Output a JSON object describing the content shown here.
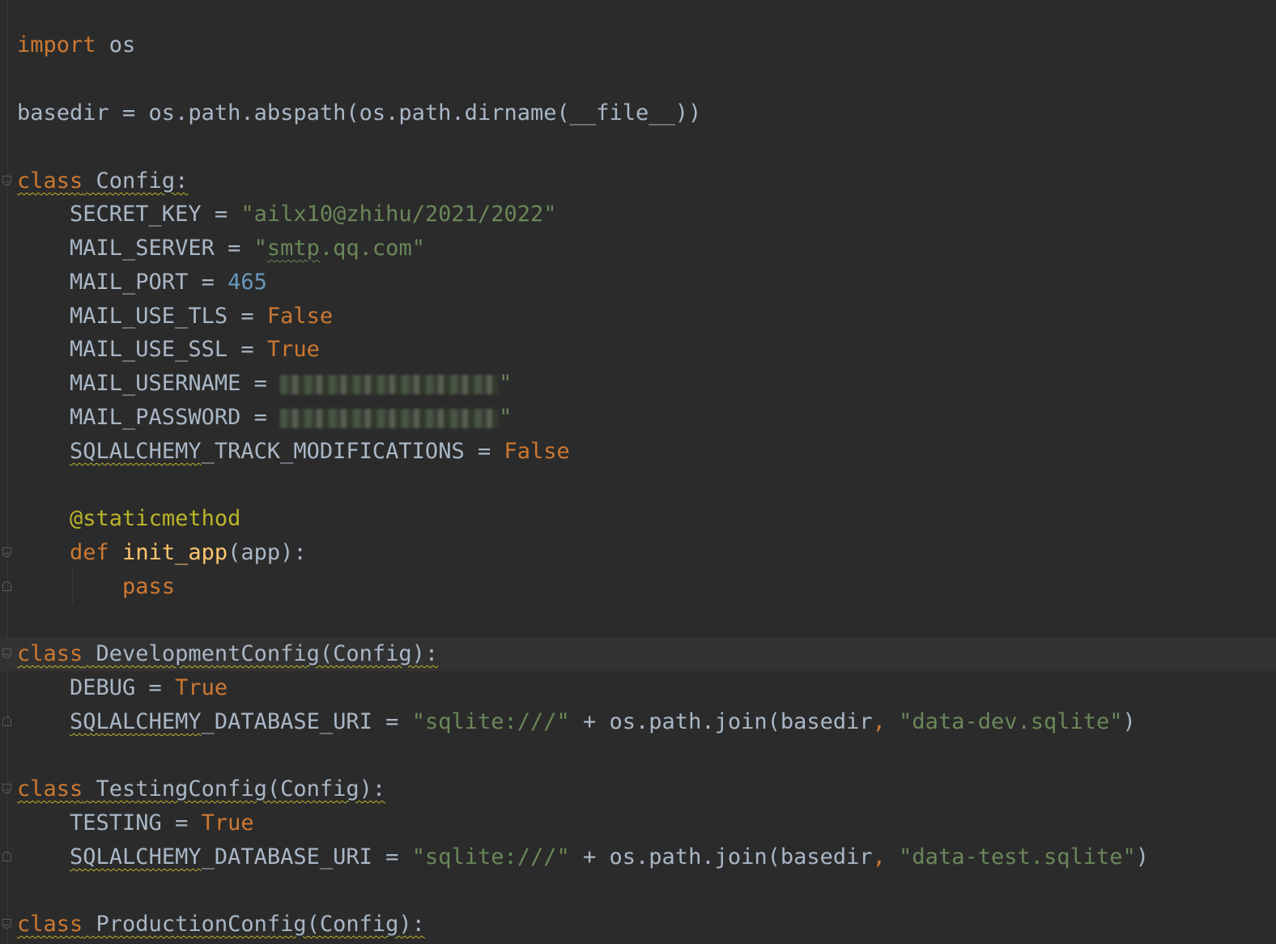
{
  "editor": {
    "language": "python",
    "colors": {
      "background": "#2b2b2b",
      "current_line": "#323232",
      "keyword": "#cc7832",
      "number": "#6897bb",
      "string": "#6a8759",
      "function": "#ffc66d",
      "decorator": "#bbb529",
      "text": "#a9b7c6"
    },
    "lines": [
      {
        "tokens": [
          {
            "type": "kw",
            "text": "import"
          },
          {
            "type": "plain",
            "text": " os"
          }
        ]
      },
      {
        "tokens": [
          {
            "type": "plain",
            "text": "basedir = os.path.abspath(os.path.dirname(__file__))"
          }
        ]
      },
      {
        "fold": "start",
        "tokens": [
          {
            "type": "kw",
            "text": "class",
            "u": 1
          },
          {
            "type": "plain",
            "text": " Config:",
            "u": 1
          }
        ]
      },
      {
        "tokens": [
          {
            "type": "plain",
            "text": "    SECRET_KEY = "
          },
          {
            "type": "str",
            "text": "\"ailx10@zhihu/2021/2022\""
          }
        ]
      },
      {
        "tokens": [
          {
            "type": "plain",
            "text": "    MAIL_SERVER = "
          },
          {
            "type": "str",
            "text": "\""
          },
          {
            "type": "str",
            "text": "smtp",
            "u": 1
          },
          {
            "type": "str",
            "text": ".qq.com\""
          }
        ]
      },
      {
        "tokens": [
          {
            "type": "plain",
            "text": "    MAIL_PORT = "
          },
          {
            "type": "num",
            "text": "465"
          }
        ]
      },
      {
        "tokens": [
          {
            "type": "plain",
            "text": "    MAIL_USE_TLS = "
          },
          {
            "type": "kw",
            "text": "False"
          }
        ]
      },
      {
        "tokens": [
          {
            "type": "plain",
            "text": "    MAIL_USE_SSL = "
          },
          {
            "type": "kw",
            "text": "True"
          }
        ]
      },
      {
        "tokens": [
          {
            "type": "plain",
            "text": "    MAIL_USERNAME = "
          },
          {
            "type": "redacted",
            "text": ""
          },
          {
            "type": "str",
            "text": "\""
          }
        ]
      },
      {
        "tokens": [
          {
            "type": "plain",
            "text": "    MAIL_PASSWORD = "
          },
          {
            "type": "redacted",
            "text": ""
          },
          {
            "type": "str",
            "text": "\""
          }
        ]
      },
      {
        "tokens": [
          {
            "type": "plain",
            "text": "    "
          },
          {
            "type": "plain",
            "text": "SQLALCHEMY",
            "u": 1
          },
          {
            "type": "plain",
            "text": "_TRACK_MODIFICATIONS = "
          },
          {
            "type": "kw",
            "text": "False"
          }
        ]
      },
      {
        "tokens": [
          {
            "type": "plain",
            "text": "    "
          },
          {
            "type": "dec",
            "text": "@staticmethod"
          }
        ]
      },
      {
        "fold": "start",
        "tokens": [
          {
            "type": "plain",
            "text": "    "
          },
          {
            "type": "kw",
            "text": "def"
          },
          {
            "type": "plain",
            "text": " "
          },
          {
            "type": "fn",
            "text": "init_app"
          },
          {
            "type": "plain",
            "text": "(app):"
          }
        ]
      },
      {
        "fold": "end",
        "tokens": [
          {
            "type": "plain",
            "text": "        "
          },
          {
            "type": "kw",
            "text": "pass"
          }
        ]
      },
      {
        "fold": "start",
        "current": true,
        "tokens": [
          {
            "type": "kw",
            "text": "class",
            "u": 1
          },
          {
            "type": "plain",
            "text": " DevelopmentConfig(Config):",
            "u": 1
          }
        ]
      },
      {
        "tokens": [
          {
            "type": "plain",
            "text": "    DEBUG = "
          },
          {
            "type": "kw",
            "text": "True"
          }
        ]
      },
      {
        "fold": "end",
        "tokens": [
          {
            "type": "plain",
            "text": "    "
          },
          {
            "type": "plain",
            "text": "SQLALCHEMY",
            "u": 1
          },
          {
            "type": "plain",
            "text": "_DATABASE_URI = "
          },
          {
            "type": "str",
            "text": "\"sqlite:///\""
          },
          {
            "type": "plain",
            "text": " + os.path.join(basedir"
          },
          {
            "type": "kw",
            "text": ","
          },
          {
            "type": "plain",
            "text": " "
          },
          {
            "type": "str",
            "text": "\"data-dev.sqlite\""
          },
          {
            "type": "plain",
            "text": ")"
          }
        ]
      },
      {
        "fold": "start",
        "tokens": [
          {
            "type": "kw",
            "text": "class",
            "u": 1
          },
          {
            "type": "plain",
            "text": " TestingConfig(Config):",
            "u": 1
          }
        ]
      },
      {
        "tokens": [
          {
            "type": "plain",
            "text": "    TESTING = "
          },
          {
            "type": "kw",
            "text": "True"
          }
        ]
      },
      {
        "fold": "end",
        "tokens": [
          {
            "type": "plain",
            "text": "    "
          },
          {
            "type": "plain",
            "text": "SQLALCHEMY",
            "u": 1
          },
          {
            "type": "plain",
            "text": "_DATABASE_URI = "
          },
          {
            "type": "str",
            "text": "\"sqlite:///\""
          },
          {
            "type": "plain",
            "text": " + os.path.join(basedir"
          },
          {
            "type": "kw",
            "text": ","
          },
          {
            "type": "plain",
            "text": " "
          },
          {
            "type": "str",
            "text": "\"data-test.sqlite\""
          },
          {
            "type": "plain",
            "text": ")"
          }
        ]
      },
      {
        "fold": "start",
        "tokens": [
          {
            "type": "kw",
            "text": "class",
            "u": 1
          },
          {
            "type": "plain",
            "text": " ProductionConfig(Config):",
            "u": 1
          }
        ]
      }
    ]
  }
}
